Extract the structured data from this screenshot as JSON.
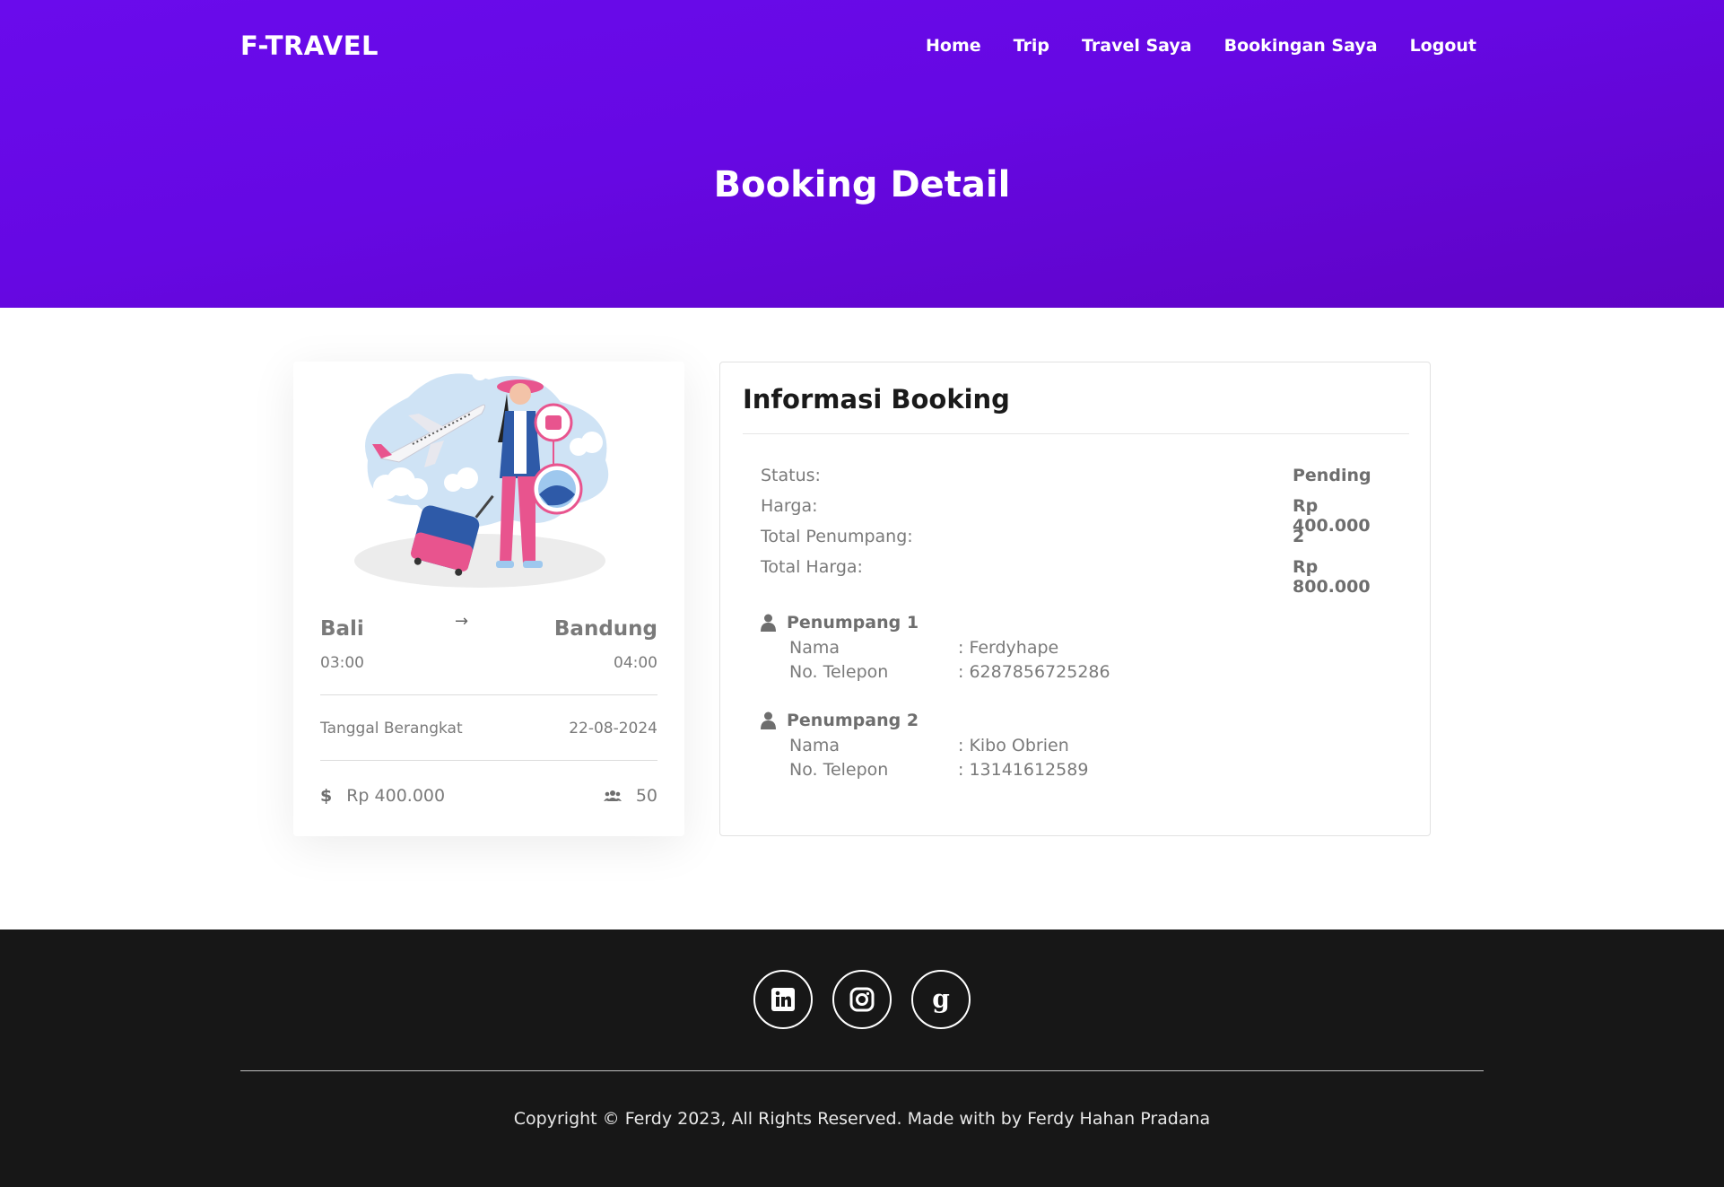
{
  "brand": "F-TRAVEL",
  "nav": [
    "Home",
    "Trip",
    "Travel Saya",
    "Bookingan Saya",
    "Logout"
  ],
  "hero_title": "Booking Detail",
  "trip": {
    "from_city": "Bali",
    "to_city": "Bandung",
    "arrow": "→",
    "depart_time": "03:00",
    "arrive_time": "04:00",
    "date_label": "Tanggal Berangkat",
    "date_value": "22-08-2024",
    "price": "Rp 400.000",
    "seats": "50",
    "price_icon": "dollar-icon",
    "seats_icon": "users-icon"
  },
  "booking": {
    "title": "Informasi Booking",
    "rows": [
      {
        "label": "Status:",
        "value": "Pending"
      },
      {
        "label": "Harga:",
        "value": "Rp 400.000"
      },
      {
        "label": "Total Penumpang:",
        "value": "2"
      },
      {
        "label": "Total Harga:",
        "value": "Rp 800.000"
      }
    ],
    "passengers": [
      {
        "heading": "Penumpang 1",
        "name_label": "Nama",
        "name_value": ": Ferdyhape",
        "phone_label": "No. Telepon",
        "phone_value": ": 6287856725286"
      },
      {
        "heading": "Penumpang 2",
        "name_label": "Nama",
        "name_value": ": Kibo Obrien",
        "phone_label": "No. Telepon",
        "phone_value": ": 13141612589"
      }
    ]
  },
  "footer": {
    "social": [
      "linkedin-icon",
      "instagram-icon",
      "goodreads-icon"
    ],
    "copyright": "Copyright © Ferdy 2023, All Rights Reserved. Made with by Ferdy Hahan Pradana"
  },
  "colors": {
    "hero": "#6608e3",
    "footer": "#171717",
    "accent_pink": "#e8548e",
    "accent_blue": "#2e5aa8"
  }
}
